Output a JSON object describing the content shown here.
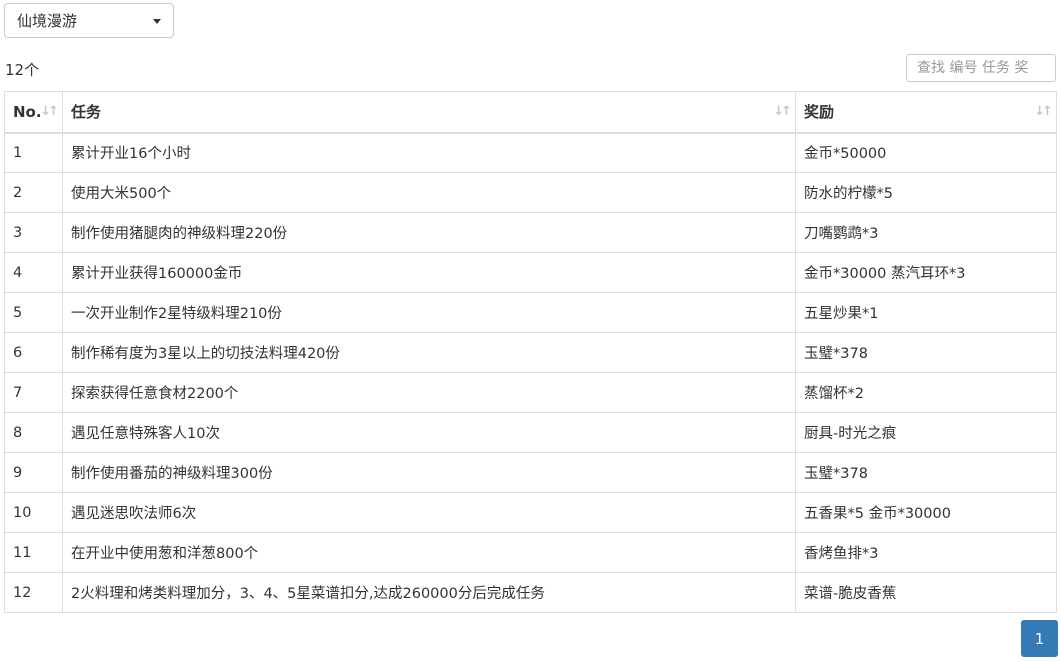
{
  "filter": {
    "selected": "仙境漫游"
  },
  "summary": {
    "count": "12个"
  },
  "search": {
    "placeholder": "查找 编号 任务 奖"
  },
  "table": {
    "headers": [
      "No.",
      "任务",
      "奖励"
    ],
    "rows": [
      {
        "no": "1",
        "task": "累计开业16个小时",
        "reward": "金币*50000"
      },
      {
        "no": "2",
        "task": "使用大米500个",
        "reward": "防水的柠檬*5"
      },
      {
        "no": "3",
        "task": "制作使用猪腿肉的神级料理220份",
        "reward": "刀嘴鹦鹉*3"
      },
      {
        "no": "4",
        "task": "累计开业获得160000金币",
        "reward": "金币*30000 蒸汽耳环*3"
      },
      {
        "no": "5",
        "task": "一次开业制作2星特级料理210份",
        "reward": "五星炒果*1"
      },
      {
        "no": "6",
        "task": "制作稀有度为3星以上的切技法料理420份",
        "reward": "玉璧*378"
      },
      {
        "no": "7",
        "task": "探索获得任意食材2200个",
        "reward": "蒸馏杯*2"
      },
      {
        "no": "8",
        "task": "遇见任意特殊客人10次",
        "reward": "厨具-时光之痕"
      },
      {
        "no": "9",
        "task": "制作使用番茄的神级料理300份",
        "reward": "玉璧*378"
      },
      {
        "no": "10",
        "task": "遇见迷思吹法师6次",
        "reward": "五香果*5 金币*30000"
      },
      {
        "no": "11",
        "task": "在开业中使用葱和洋葱800个",
        "reward": "香烤鱼排*3"
      },
      {
        "no": "12",
        "task": "2火料理和烤类料理加分，3、4、5星菜谱扣分,达成260000分后完成任务",
        "reward": "菜谱-脆皮香蕉"
      }
    ]
  },
  "pagination": {
    "current": "1"
  }
}
